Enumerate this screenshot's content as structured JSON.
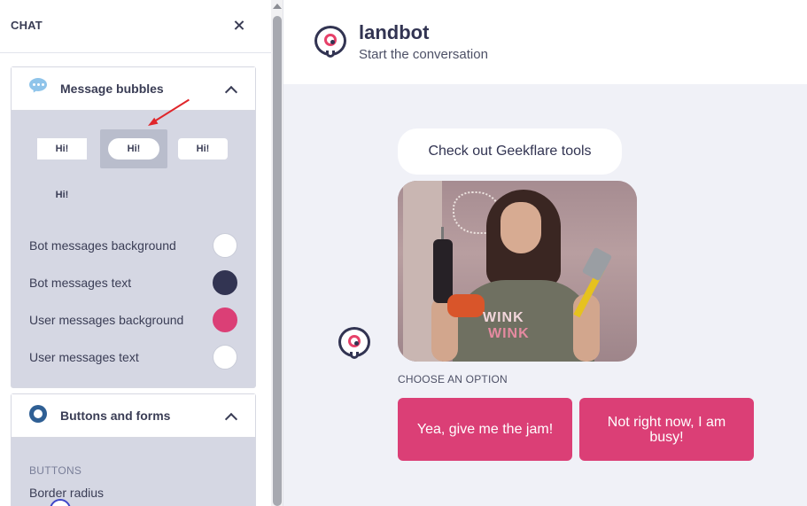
{
  "panel": {
    "title": "CHAT",
    "sections": [
      {
        "title": "Message bubbles",
        "icon": "chat-bubbles-icon",
        "shape_options": [
          "Hi!",
          "Hi!",
          "Hi!",
          "Hi!"
        ],
        "selected_shape": 2,
        "colors": [
          {
            "label": "Bot messages background",
            "color": "#ffffff"
          },
          {
            "label": "Bot messages text",
            "color": "#323452"
          },
          {
            "label": "User messages background",
            "color": "#db3f76"
          },
          {
            "label": "User messages text",
            "color": "#ffffff"
          }
        ]
      },
      {
        "title": "Buttons and forms",
        "icon": "radio-button-icon",
        "subheading": "BUTTONS",
        "border_radius_label": "Border radius"
      }
    ]
  },
  "chat": {
    "bot_name": "landbot",
    "subtitle": "Start the conversation",
    "message": "Check out Geekflare tools",
    "gif_text": [
      "WINK",
      "WINK"
    ],
    "choose_label": "CHOOSE AN OPTION",
    "options": [
      "Yea, give me the jam!",
      "Not right now, I am busy!"
    ]
  },
  "colors": {
    "accent": "#db3f76",
    "dark": "#323452",
    "preview_background": "#f0f1f7",
    "section_background": "#d5d7e3",
    "annotation_arrow": "#e0262b"
  }
}
